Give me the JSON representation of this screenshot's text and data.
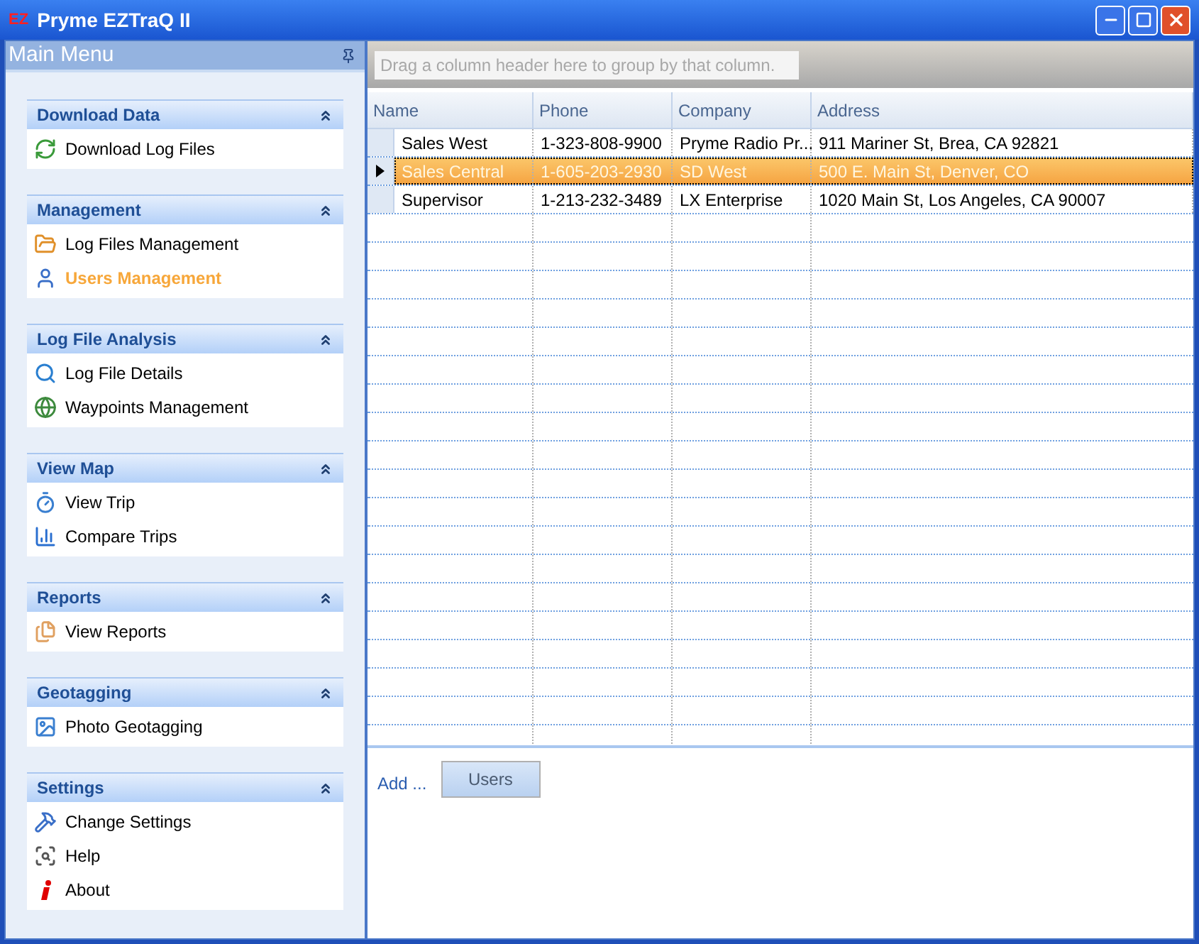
{
  "window": {
    "title": "Pryme EZTraQ II",
    "logo": "EZ"
  },
  "main_menu": {
    "title": "Main Menu",
    "groups": [
      {
        "title": "Download Data",
        "items": [
          {
            "label": "Download Log Files",
            "selected": false
          }
        ]
      },
      {
        "title": "Management",
        "items": [
          {
            "label": "Log Files Management",
            "selected": false
          },
          {
            "label": "Users Management",
            "selected": true
          }
        ]
      },
      {
        "title": "Log File Analysis",
        "items": [
          {
            "label": "Log File Details",
            "selected": false
          },
          {
            "label": "Waypoints Management",
            "selected": false
          }
        ]
      },
      {
        "title": "View Map",
        "items": [
          {
            "label": "View Trip",
            "selected": false
          },
          {
            "label": "Compare Trips",
            "selected": false
          }
        ]
      },
      {
        "title": "Reports",
        "items": [
          {
            "label": "View Reports",
            "selected": false
          }
        ]
      },
      {
        "title": "Geotagging",
        "items": [
          {
            "label": "Photo Geotagging",
            "selected": false
          }
        ]
      },
      {
        "title": "Settings",
        "items": [
          {
            "label": "Change Settings",
            "selected": false
          },
          {
            "label": "Help",
            "selected": false
          },
          {
            "label": "About",
            "selected": false
          }
        ]
      }
    ]
  },
  "grid": {
    "group_hint": "Drag a column header here to group by that column.",
    "columns": [
      "Name",
      "Phone",
      "Company",
      "Address"
    ],
    "rows": [
      {
        "selected": false,
        "cells": [
          "Sales West",
          "1-323-808-9900",
          "Pryme Radio Pr...",
          "911 Mariner St, Brea, CA 92821"
        ]
      },
      {
        "selected": true,
        "cells": [
          "Sales Central",
          "1-605-203-2930",
          "SD West",
          "500 E. Main St, Denver, CO"
        ]
      },
      {
        "selected": false,
        "cells": [
          "Supervisor",
          "1-213-232-3489",
          "LX Enterprise",
          "1020 Main St, Los Angeles, CA 90007"
        ]
      }
    ]
  },
  "footer": {
    "add_label": "Add ...",
    "button": "Users"
  }
}
